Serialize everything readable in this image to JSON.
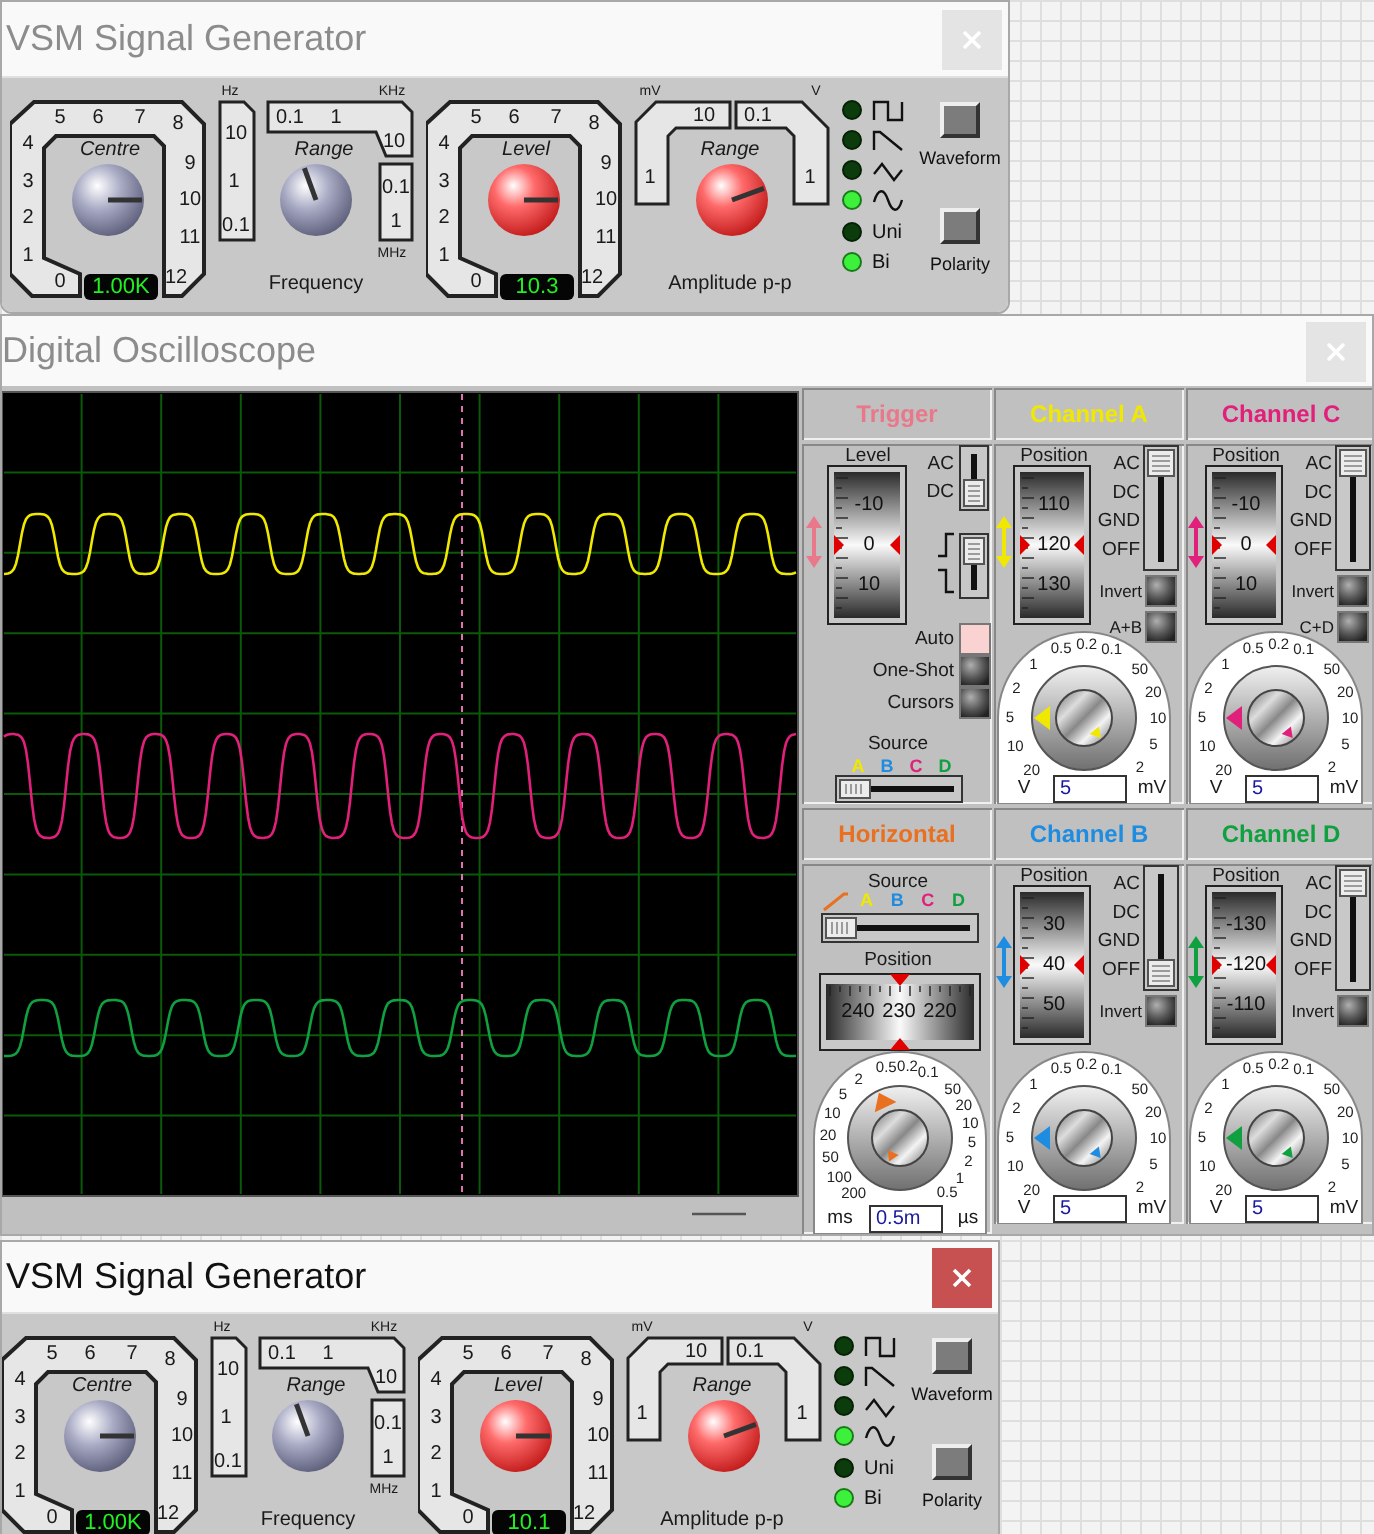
{
  "generators": [
    {
      "title": "VSM Signal Generator",
      "active": false,
      "centre": {
        "label": "Centre",
        "top_scale": [
          "5",
          "6",
          "7",
          "8"
        ],
        "left_scale": [
          "4",
          "3",
          "2",
          "1",
          "0"
        ],
        "right_scale": [
          "9",
          "10",
          "11",
          "12"
        ],
        "readout": "1.00K"
      },
      "frequency": {
        "label": "Range",
        "units": [
          "Hz",
          "KHz",
          "MHz"
        ],
        "left_scale": [
          "10",
          "1",
          "0.1"
        ],
        "top_scale": [
          "0.1",
          "1",
          "10"
        ],
        "right_scale": [
          "0.1",
          "1"
        ],
        "caption": "Frequency"
      },
      "level": {
        "label": "Level",
        "top_scale": [
          "5",
          "6",
          "7",
          "8"
        ],
        "left_scale": [
          "4",
          "3",
          "2",
          "1",
          "0"
        ],
        "right_scale": [
          "9",
          "10",
          "11",
          "12"
        ],
        "readout": "10.3"
      },
      "amplitude": {
        "label": "Range",
        "units": [
          "mV",
          "V"
        ],
        "left_scale": [
          "1"
        ],
        "top_scale": [
          "10",
          "0.1"
        ],
        "right_scale": [
          "1"
        ],
        "caption": "Amplitude p-p"
      },
      "waveforms": [
        {
          "kind": "square",
          "selected": false
        },
        {
          "kind": "sawtooth",
          "selected": false
        },
        {
          "kind": "triangle",
          "selected": false
        },
        {
          "kind": "sine",
          "selected": true
        }
      ],
      "polarity": [
        {
          "label": "Uni",
          "selected": false
        },
        {
          "label": "Bi",
          "selected": true
        }
      ],
      "buttons": [
        "Waveform",
        "Polarity"
      ]
    },
    {
      "title": "VSM Signal Generator",
      "active": true,
      "centre": {
        "label": "Centre",
        "top_scale": [
          "5",
          "6",
          "7",
          "8"
        ],
        "left_scale": [
          "4",
          "3",
          "2",
          "1",
          "0"
        ],
        "right_scale": [
          "9",
          "10",
          "11",
          "12"
        ],
        "readout": "1.00K"
      },
      "frequency": {
        "label": "Range",
        "units": [
          "Hz",
          "KHz",
          "MHz"
        ],
        "left_scale": [
          "10",
          "1",
          "0.1"
        ],
        "top_scale": [
          "0.1",
          "1",
          "10"
        ],
        "right_scale": [
          "0.1",
          "1"
        ],
        "caption": "Frequency"
      },
      "level": {
        "label": "Level",
        "top_scale": [
          "5",
          "6",
          "7",
          "8"
        ],
        "left_scale": [
          "4",
          "3",
          "2",
          "1",
          "0"
        ],
        "right_scale": [
          "9",
          "10",
          "11",
          "12"
        ],
        "readout": "10.1"
      },
      "amplitude": {
        "label": "Range",
        "units": [
          "mV",
          "V"
        ],
        "left_scale": [
          "1"
        ],
        "top_scale": [
          "10",
          "0.1"
        ],
        "right_scale": [
          "1"
        ],
        "caption": "Amplitude p-p"
      },
      "waveforms": [
        {
          "kind": "square",
          "selected": false
        },
        {
          "kind": "sawtooth",
          "selected": false
        },
        {
          "kind": "triangle",
          "selected": false
        },
        {
          "kind": "sine",
          "selected": true
        }
      ],
      "polarity": [
        {
          "label": "Uni",
          "selected": false
        },
        {
          "label": "Bi",
          "selected": true
        }
      ],
      "buttons": [
        "Waveform",
        "Polarity"
      ]
    }
  ],
  "oscilloscope": {
    "title": "Digital Oscilloscope",
    "active": false,
    "trigger": {
      "title": "Trigger",
      "color": "#e8788a",
      "level_label": "Level",
      "level_scale": [
        "-10",
        "0",
        "10"
      ],
      "coupling": {
        "labels": [
          "AC",
          "DC"
        ]
      },
      "edge": {
        "icons": [
          {
            "kind": "rising"
          },
          {
            "kind": "falling"
          }
        ]
      },
      "modes": [
        {
          "label": "Auto",
          "on": true
        },
        {
          "label": "One-Shot",
          "on": false
        },
        {
          "label": "Cursors",
          "on": false
        }
      ],
      "source_label": "Source",
      "sources": [
        {
          "label": "A",
          "color": "#f0e800"
        },
        {
          "label": "B",
          "color": "#1e8ce0"
        },
        {
          "label": "C",
          "color": "#e0207a"
        },
        {
          "label": "D",
          "color": "#10a040"
        }
      ],
      "source_slider": {
        "level": 0
      }
    },
    "horizontal": {
      "title": "Horizontal",
      "color": "#e87020",
      "source_label": "Source",
      "sources": [
        {
          "kind": "ramp"
        },
        {
          "kind": "letter",
          "label": "A",
          "color": "#f0e800"
        },
        {
          "kind": "letter",
          "label": "B",
          "color": "#1e8ce0"
        },
        {
          "kind": "letter",
          "label": "C",
          "color": "#e0207a"
        },
        {
          "kind": "letter",
          "label": "D",
          "color": "#10a040"
        }
      ],
      "source_slider": {
        "level": 0
      },
      "position_label": "Position",
      "position_scale": [
        "240",
        "230",
        "220"
      ],
      "ms_top_scale": [
        "0.5",
        "0.2",
        "0.1"
      ],
      "ms_side_scale": [
        "2",
        "5",
        "10",
        "20",
        "50",
        "100",
        "200"
      ],
      "us_scale": [
        "50",
        "20",
        "10",
        "5",
        "2",
        "1",
        "0.5"
      ],
      "units": [
        "ms",
        "µs"
      ],
      "readout": "0.5m"
    },
    "channels": [
      {
        "title": "Channel A",
        "color": "#f0e800",
        "position_label": "Position",
        "position_scale": [
          "110",
          "120",
          "130"
        ],
        "coupling": {
          "labels": [
            "AC",
            "DC",
            "GND",
            "OFF"
          ],
          "level": 1
        },
        "buttons": [
          {
            "label": "Invert",
            "on": false
          },
          {
            "label": "A+B",
            "on": false
          }
        ],
        "volts_top_scale": [
          "0.5",
          "0.2",
          "0.1"
        ],
        "volts_side_scale": [
          "1",
          "2",
          "5",
          "10",
          "20"
        ],
        "millivolts_scale": [
          "50",
          "20",
          "10",
          "5",
          "2"
        ],
        "units": [
          "V",
          "mV"
        ],
        "readout": "5"
      },
      {
        "title": "Channel C",
        "color": "#e0207a",
        "position_label": "Position",
        "position_scale": [
          "-10",
          "0",
          "10"
        ],
        "coupling": {
          "labels": [
            "AC",
            "DC",
            "GND",
            "OFF"
          ],
          "level": 1
        },
        "buttons": [
          {
            "label": "Invert",
            "on": false
          },
          {
            "label": "C+D",
            "on": false
          }
        ],
        "volts_top_scale": [
          "0.5",
          "0.2",
          "0.1"
        ],
        "volts_side_scale": [
          "1",
          "2",
          "5",
          "10",
          "20"
        ],
        "millivolts_scale": [
          "50",
          "20",
          "10",
          "5",
          "2"
        ],
        "units": [
          "V",
          "mV"
        ],
        "readout": "5"
      },
      {
        "title": "Channel B",
        "color": "#1e8ce0",
        "position_label": "Position",
        "position_scale": [
          "30",
          "40",
          "50"
        ],
        "coupling": {
          "labels": [
            "AC",
            "DC",
            "GND",
            "OFF"
          ],
          "level": 0
        },
        "buttons": [
          {
            "label": "Invert",
            "on": false
          }
        ],
        "volts_top_scale": [
          "0.5",
          "0.2",
          "0.1"
        ],
        "volts_side_scale": [
          "1",
          "2",
          "5",
          "10",
          "20"
        ],
        "millivolts_scale": [
          "50",
          "20",
          "10",
          "5",
          "2"
        ],
        "units": [
          "V",
          "mV"
        ],
        "readout": "5"
      },
      {
        "title": "Channel D",
        "color": "#10a040",
        "position_label": "Position",
        "position_scale": [
          "-130",
          "-120",
          "-110"
        ],
        "coupling": {
          "labels": [
            "AC",
            "DC",
            "GND",
            "OFF"
          ],
          "level": 1
        },
        "buttons": [
          {
            "label": "Invert",
            "on": false
          }
        ],
        "volts_top_scale": [
          "0.5",
          "0.2",
          "0.1"
        ],
        "volts_side_scale": [
          "1",
          "2",
          "5",
          "10",
          "20"
        ],
        "millivolts_scale": [
          "50",
          "20",
          "10",
          "5",
          "2"
        ],
        "units": [
          "V",
          "mV"
        ],
        "readout": "5"
      }
    ]
  }
}
